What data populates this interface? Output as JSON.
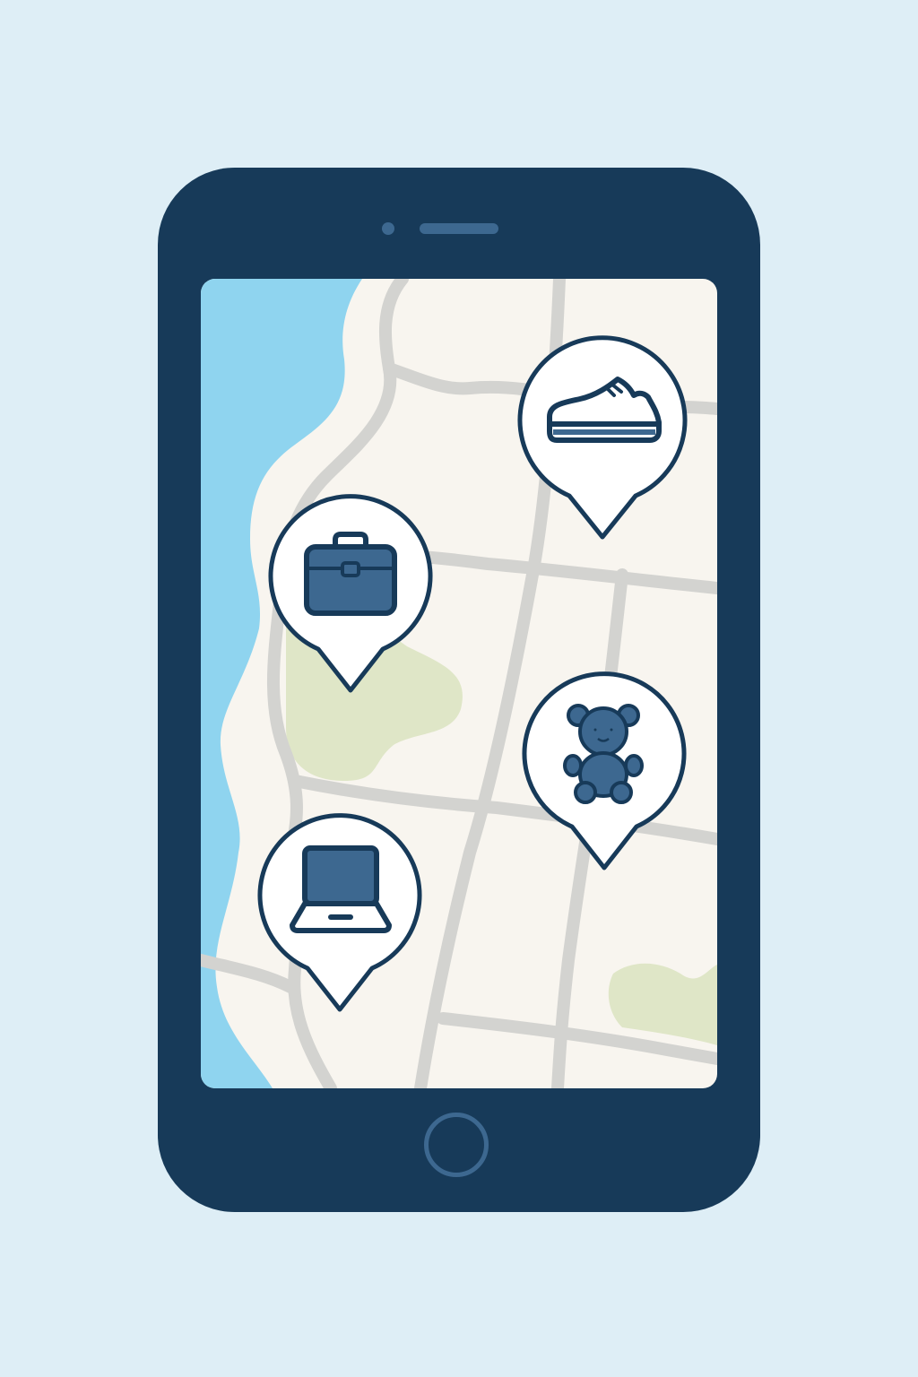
{
  "app": {
    "view": "map"
  },
  "colors": {
    "background": "#deeef6",
    "phone_body": "#173a59",
    "phone_accent": "#3d6890",
    "map_land": "#f8f5ef",
    "map_water": "#8fd4ef",
    "map_park": "#dfe6c7",
    "map_road": "#d3d3d0",
    "pin_fill": "#ffffff",
    "pin_stroke": "#173a59",
    "icon_fill": "#3d6890"
  },
  "map": {
    "pins": [
      {
        "id": "shoe-store",
        "icon": "sneaker-icon"
      },
      {
        "id": "bag-store",
        "icon": "briefcase-icon"
      },
      {
        "id": "toy-store",
        "icon": "teddy-bear-icon"
      },
      {
        "id": "electronics-store",
        "icon": "laptop-icon"
      }
    ]
  }
}
